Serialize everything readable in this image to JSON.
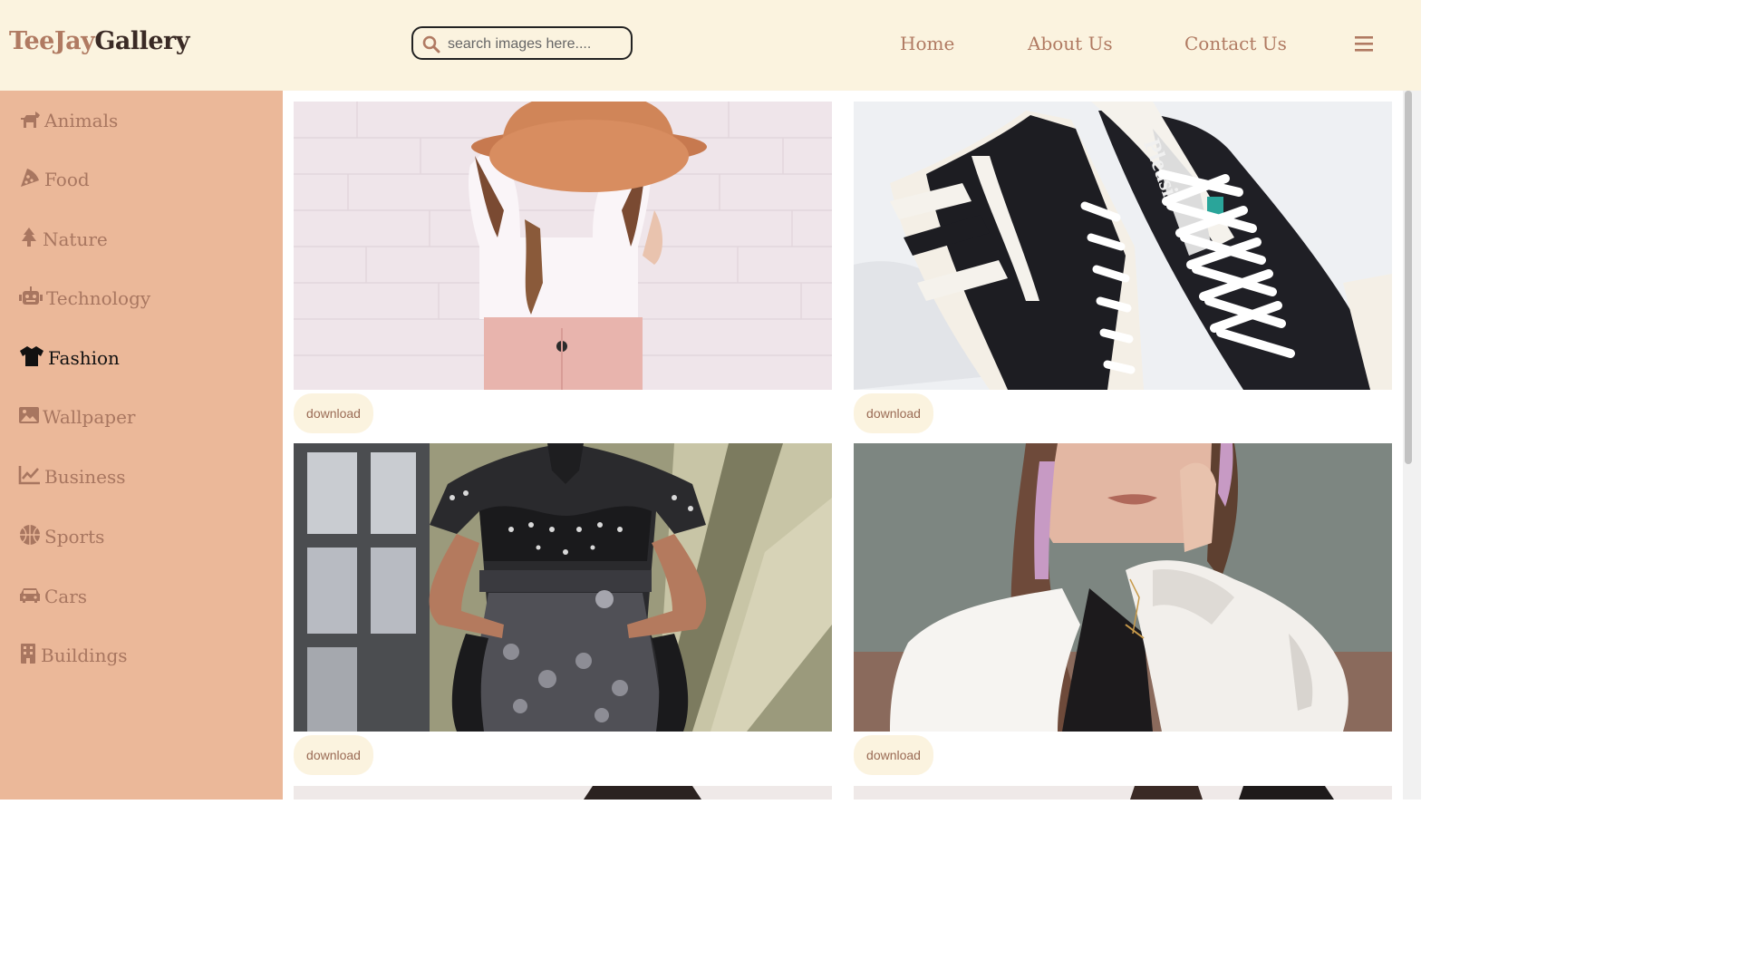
{
  "brand": {
    "part1": "TeeJay",
    "part2": "Gallery"
  },
  "search": {
    "placeholder": "search images here...."
  },
  "nav": {
    "home": "Home",
    "about": "About Us",
    "contact": "Contact Us"
  },
  "sidebar": {
    "items": [
      {
        "label": "Animals",
        "icon": "dog-icon"
      },
      {
        "label": "Food",
        "icon": "pizza-icon"
      },
      {
        "label": "Nature",
        "icon": "tree-icon"
      },
      {
        "label": "Technology",
        "icon": "robot-icon"
      },
      {
        "label": "Fashion",
        "icon": "shirt-icon",
        "active": true
      },
      {
        "label": "Wallpaper",
        "icon": "image-icon"
      },
      {
        "label": "Business",
        "icon": "chart-line-icon"
      },
      {
        "label": "Sports",
        "icon": "basketball-icon"
      },
      {
        "label": "Cars",
        "icon": "car-icon"
      },
      {
        "label": "Buildings",
        "icon": "building-icon"
      }
    ]
  },
  "gallery": {
    "download_label": "download",
    "images": [
      {
        "subject": "woman in sun hat and white t-shirt"
      },
      {
        "subject": "black and white sneakers"
      },
      {
        "subject": "black embroidered dress"
      },
      {
        "subject": "woman in white jacket"
      }
    ]
  },
  "colors": {
    "header_bg": "#fbf3df",
    "sidebar_bg": "#ebb899",
    "accent": "#b07a62",
    "active": "#111111"
  }
}
